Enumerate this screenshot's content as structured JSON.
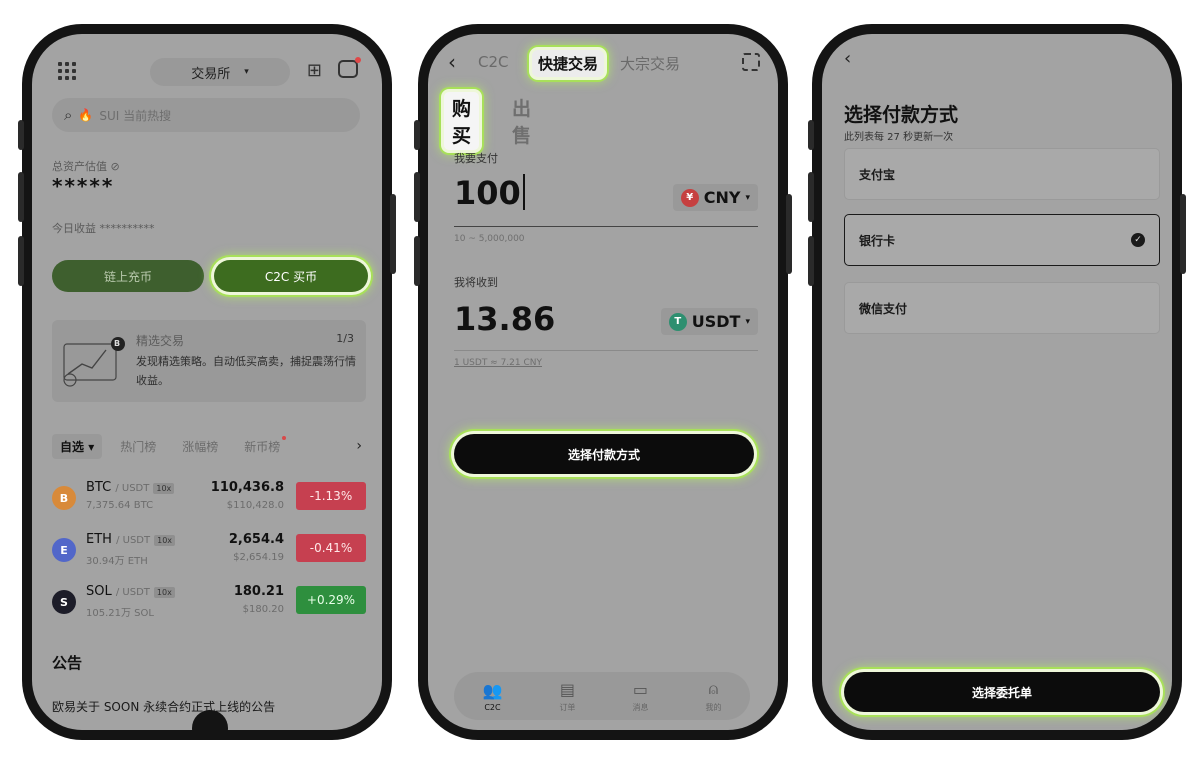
{
  "colors": {
    "screen_overlay": "#a3a3a3",
    "highlight": "#a8e05a",
    "green_button": "#3d6c1f",
    "red_change": "#c64050",
    "green_change": "#2e8f3e",
    "black_button": "#0c0c0c"
  },
  "phone1": {
    "exchange_label": "交易所",
    "search_placeholder": "SUI 当前热搜",
    "total_asset_label": "总资产估值",
    "total_asset_value": "*****",
    "today_earnings": "今日收益 **********",
    "buttons": {
      "onchain": "链上充币",
      "c2c_buy": "C2C 买币"
    },
    "card": {
      "title": "精选交易",
      "page": "1/3",
      "desc": "发现精选策略。自动低买高卖，捕捉震荡行情收益。",
      "badge": "B"
    },
    "tabs": {
      "watchlist": "自选",
      "hot": "热门榜",
      "gainers": "涨幅榜",
      "new": "新币榜"
    },
    "coins": [
      {
        "symbol": "BTC",
        "quote": "/ USDT",
        "lev": "10x",
        "volume": "7,375.64 BTC",
        "price": "110,436.8",
        "sub": "$110,428.0",
        "change": "-1.13%",
        "icon_letter": "B"
      },
      {
        "symbol": "ETH",
        "quote": "/ USDT",
        "lev": "10x",
        "volume": "30.94万 ETH",
        "price": "2,654.4",
        "sub": "$2,654.19",
        "change": "-0.41%",
        "icon_letter": "E"
      },
      {
        "symbol": "SOL",
        "quote": "/ USDT",
        "lev": "10x",
        "volume": "105.21万 SOL",
        "price": "180.21",
        "sub": "$180.20",
        "change": "+0.29%",
        "icon_letter": "S"
      }
    ],
    "announcement_title": "公告",
    "announcement_text": "欧易关于 SOON 永续合约正式上线的公告"
  },
  "phone2": {
    "nav": {
      "c2c": "C2C",
      "quick": "快捷交易",
      "bulk": "大宗交易"
    },
    "buy": "购买",
    "sell": "出售",
    "pay_label": "我要支付",
    "pay_amount": "100",
    "pay_currency": "CNY",
    "pay_currency_icon": "¥",
    "range_hint": "10 ~ 5,000,000",
    "receive_label": "我将收到",
    "receive_amount": "13.86",
    "receive_currency": "USDT",
    "receive_currency_icon": "T",
    "rate": "1 USDT ≈ 7.21 CNY",
    "select_pay_btn": "选择付款方式",
    "bottom_nav": {
      "c2c": "C2C",
      "orders": "订单",
      "messages": "消息",
      "mine": "我的"
    }
  },
  "phone3": {
    "title": "选择付款方式",
    "subtitle": "此列表每 27 秒更新一次",
    "options": {
      "alipay": "支付宝",
      "bank": "银行卡",
      "wechat": "微信支付"
    },
    "select_order_btn": "选择委托单"
  }
}
